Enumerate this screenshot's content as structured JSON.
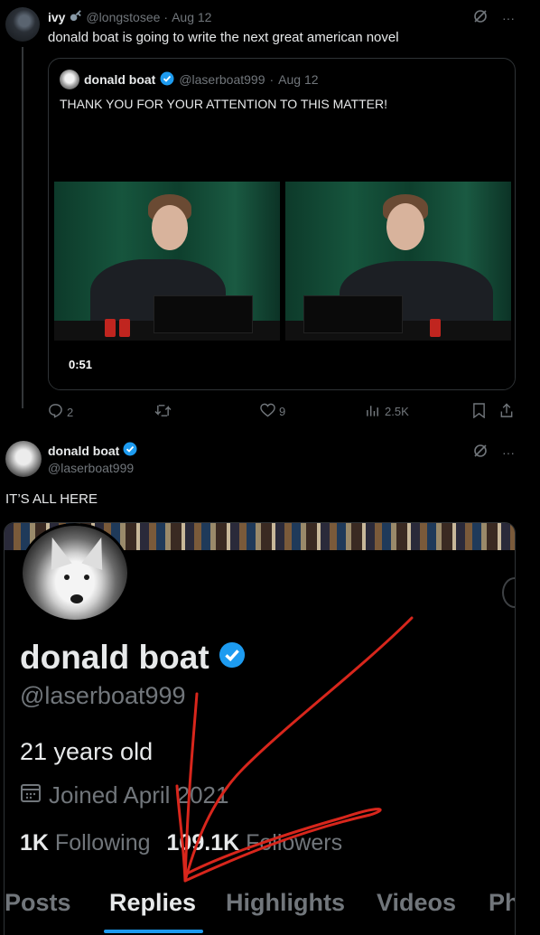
{
  "tweet1": {
    "author_name": "ivy",
    "author_handle": "@longstosee",
    "date": "Aug 12",
    "text": "donald boat is going to write the next great american novel",
    "quote": {
      "author_name": "donald boat",
      "author_handle": "@laserboat999",
      "date": "Aug 12",
      "text": "THANK YOU FOR YOUR ATTENTION TO THIS MATTER!",
      "video_duration": "0:51"
    },
    "actions": {
      "replies": "2",
      "likes": "9",
      "views": "2.5K"
    }
  },
  "tweet2": {
    "author_name": "donald boat",
    "author_handle": "@laserboat999",
    "text": "IT’S ALL HERE",
    "profile": {
      "name": "donald boat",
      "handle": "@laserboat999",
      "bio": "21 years old",
      "joined": "Joined April 2021",
      "following_count": "1K",
      "following_label": "Following",
      "followers_count": "109.1K",
      "followers_label": "Followers",
      "tabs": [
        "Posts",
        "Replies",
        "Highlights",
        "Videos",
        "Ph"
      ],
      "active_tab": "Replies"
    }
  },
  "icons": {
    "more": "more-icon",
    "grok": "grok-icon",
    "verified": "verified-badge-icon",
    "reply": "reply-icon",
    "retweet": "retweet-icon",
    "like": "like-icon",
    "views": "views-icon",
    "bookmark": "bookmark-icon",
    "share": "share-icon",
    "calendar": "calendar-icon"
  },
  "colors": {
    "background": "#000000",
    "text": "#e7e9ea",
    "muted": "#71767b",
    "verified_blue": "#1d9bf0",
    "annotation_red": "#d8261c"
  }
}
